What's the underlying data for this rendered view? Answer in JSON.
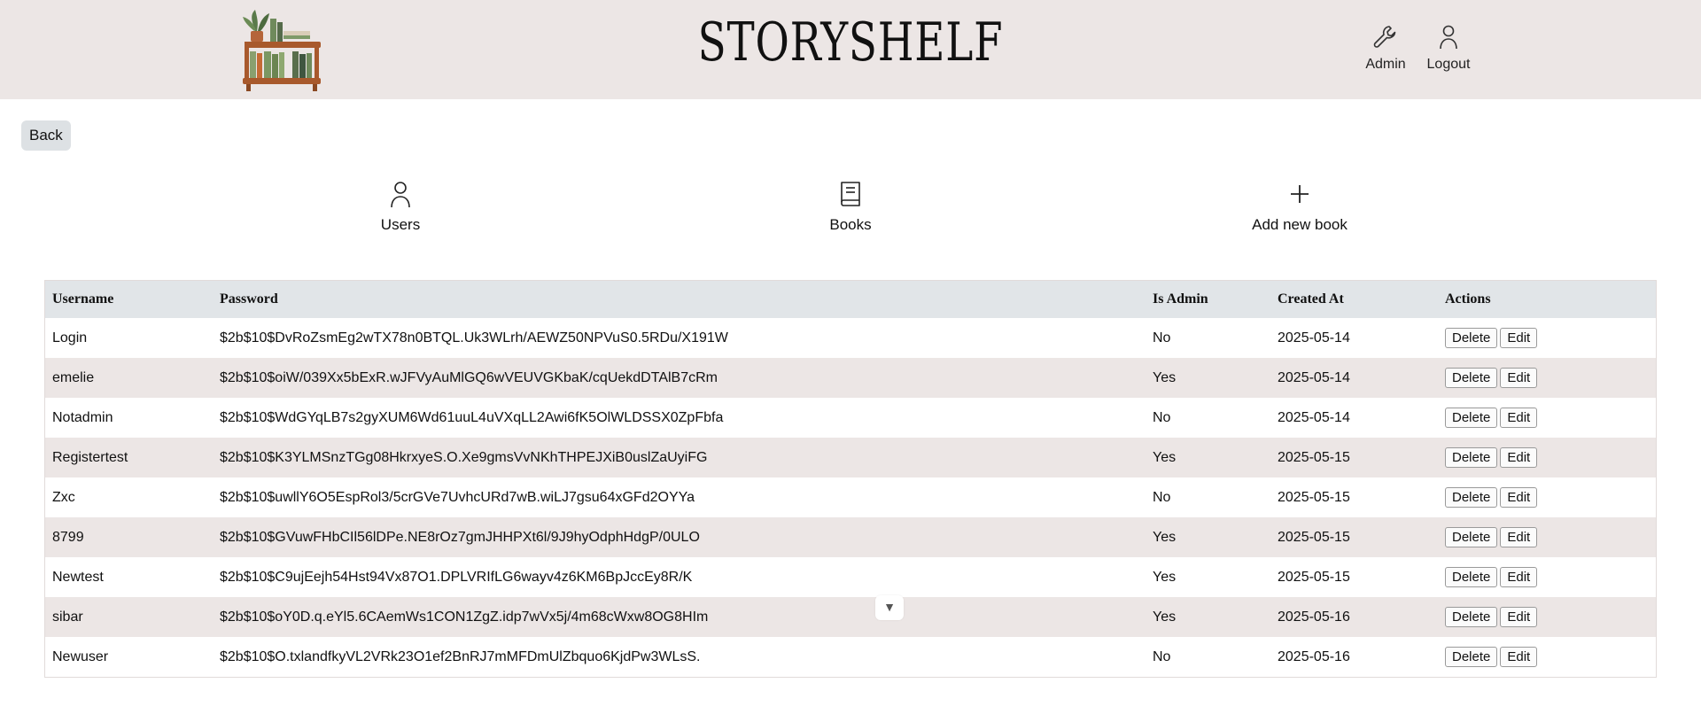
{
  "header": {
    "brand": "STORYSHELF",
    "admin_label": "Admin",
    "logout_label": "Logout"
  },
  "back_label": "Back",
  "tiles": {
    "users": "Users",
    "books": "Books",
    "add_book": "Add new book"
  },
  "table": {
    "columns": [
      "Username",
      "Password",
      "Is Admin",
      "Created At",
      "Actions"
    ],
    "delete_label": "Delete",
    "edit_label": "Edit",
    "rows": [
      {
        "username": "Login",
        "password": "$2b$10$DvRoZsmEg2wTX78n0BTQL.Uk3WLrh/AEWZ50NPVuS0.5RDu/X191W",
        "is_admin": "No",
        "created_at": "2025-05-14"
      },
      {
        "username": "emelie",
        "password": "$2b$10$oiW/039Xx5bExR.wJFVyAuMlGQ6wVEUVGKbaK/cqUekdDTAlB7cRm",
        "is_admin": "Yes",
        "created_at": "2025-05-14"
      },
      {
        "username": "Notadmin",
        "password": "$2b$10$WdGYqLB7s2gyXUM6Wd61uuL4uVXqLL2Awi6fK5OlWLDSSX0ZpFbfa",
        "is_admin": "No",
        "created_at": "2025-05-14"
      },
      {
        "username": "Registertest",
        "password": "$2b$10$K3YLMSnzTGg08HkrxyeS.O.Xe9gmsVvNKhTHPEJXiB0uslZaUyiFG",
        "is_admin": "Yes",
        "created_at": "2025-05-15"
      },
      {
        "username": "Zxc",
        "password": "$2b$10$uwllY6O5EspRol3/5crGVe7UvhcURd7wB.wiLJ7gsu64xGFd2OYYa",
        "is_admin": "No",
        "created_at": "2025-05-15"
      },
      {
        "username": "8799",
        "password": "$2b$10$GVuwFHbCIl56lDPe.NE8rOz7gmJHHPXt6l/9J9hyOdphHdgP/0ULO",
        "is_admin": "Yes",
        "created_at": "2025-05-15"
      },
      {
        "username": "Newtest",
        "password": "$2b$10$C9ujEejh54Hst94Vx87O1.DPLVRIfLG6wayv4z6KM6BpJccEy8R/K",
        "is_admin": "Yes",
        "created_at": "2025-05-15"
      },
      {
        "username": "sibar",
        "password": "$2b$10$oY0D.q.eYl5.6CAemWs1CON1ZgZ.idp7wVx5j/4m68cWxw8OG8HIm",
        "is_admin": "Yes",
        "created_at": "2025-05-16"
      },
      {
        "username": "Newuser",
        "password": "$2b$10$O.txlandfkyVL2VRk23O1ef2BnRJ7mMFDmUlZbquo6KjdPw3WLsS.",
        "is_admin": "No",
        "created_at": "2025-05-16"
      }
    ]
  },
  "colors": {
    "header_bg": "#ece6e5",
    "table_head_bg": "#e1e5e8",
    "row_stripe_bg": "#ece6e5",
    "back_button_bg": "#dde1e4"
  }
}
